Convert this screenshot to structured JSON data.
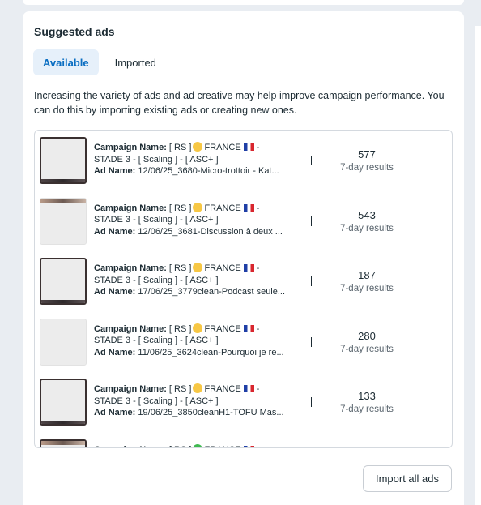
{
  "panel": {
    "title": "Suggested ads",
    "tabs": [
      {
        "label": "Available",
        "active": true
      },
      {
        "label": "Imported",
        "active": false
      }
    ],
    "description": "Increasing the variety of ads and ad creative may help improve campaign performance. You can do this by importing existing ads or creating new ones.",
    "import_button": "Import all ads"
  },
  "ads": [
    {
      "campaign_label": "Campaign Name:",
      "campaign_prefix": "[ RS ]",
      "campaign_country": "FRANCE",
      "campaign_suffix": "-",
      "campaign_line2": "STADE 3 - [ Scaling ] - [ ASC+ ]",
      "ad_label": "Ad Name:",
      "ad_name": "12/06/25_3680-Micro-trottoir - Kat...",
      "metric_value": "577",
      "metric_label": "7-day results",
      "status_icon": "yellow-circle-icon"
    },
    {
      "campaign_label": "Campaign Name:",
      "campaign_prefix": "[ RS ]",
      "campaign_country": "FRANCE",
      "campaign_suffix": "-",
      "campaign_line2": "STADE 3 - [ Scaling ] - [ ASC+ ]",
      "ad_label": "Ad Name:",
      "ad_name": "12/06/25_3681-Discussion à deux ...",
      "metric_value": "543",
      "metric_label": "7-day results",
      "status_icon": "yellow-circle-icon"
    },
    {
      "campaign_label": "Campaign Name:",
      "campaign_prefix": "[ RS ]",
      "campaign_country": "FRANCE",
      "campaign_suffix": "-",
      "campaign_line2": "STADE 3 - [ Scaling ] - [ ASC+ ]",
      "ad_label": "Ad Name:",
      "ad_name": "17/06/25_3779clean-Podcast seule...",
      "metric_value": "187",
      "metric_label": "7-day results",
      "status_icon": "yellow-circle-icon"
    },
    {
      "campaign_label": "Campaign Name:",
      "campaign_prefix": "[ RS ]",
      "campaign_country": "FRANCE",
      "campaign_suffix": "-",
      "campaign_line2": "STADE 3 - [ Scaling ] - [ ASC+ ]",
      "ad_label": "Ad Name:",
      "ad_name": "11/06/25_3624clean-Pourquoi je re...",
      "metric_value": "280",
      "metric_label": "7-day results",
      "status_icon": "yellow-circle-icon"
    },
    {
      "campaign_label": "Campaign Name:",
      "campaign_prefix": "[ RS ]",
      "campaign_country": "FRANCE",
      "campaign_suffix": "-",
      "campaign_line2": "STADE 3 - [ Scaling ] - [ ASC+ ]",
      "ad_label": "Ad Name:",
      "ad_name": "19/06/25_3850cleanH1-TOFU Mas...",
      "metric_value": "133",
      "metric_label": "7-day results",
      "status_icon": "yellow-circle-icon"
    },
    {
      "campaign_label": "Campaign Name:",
      "campaign_prefix": "[ RS ]",
      "campaign_country": "FRANCE",
      "campaign_suffix": "",
      "campaign_line2": "",
      "ad_label": "",
      "ad_name": "",
      "metric_value": "",
      "metric_label": "",
      "status_icon": "green-circle-icon"
    }
  ],
  "colors": {
    "accent": "#0a6ec2",
    "tab_active_bg": "#e6f0fa",
    "page_bg": "#e9edf2"
  }
}
